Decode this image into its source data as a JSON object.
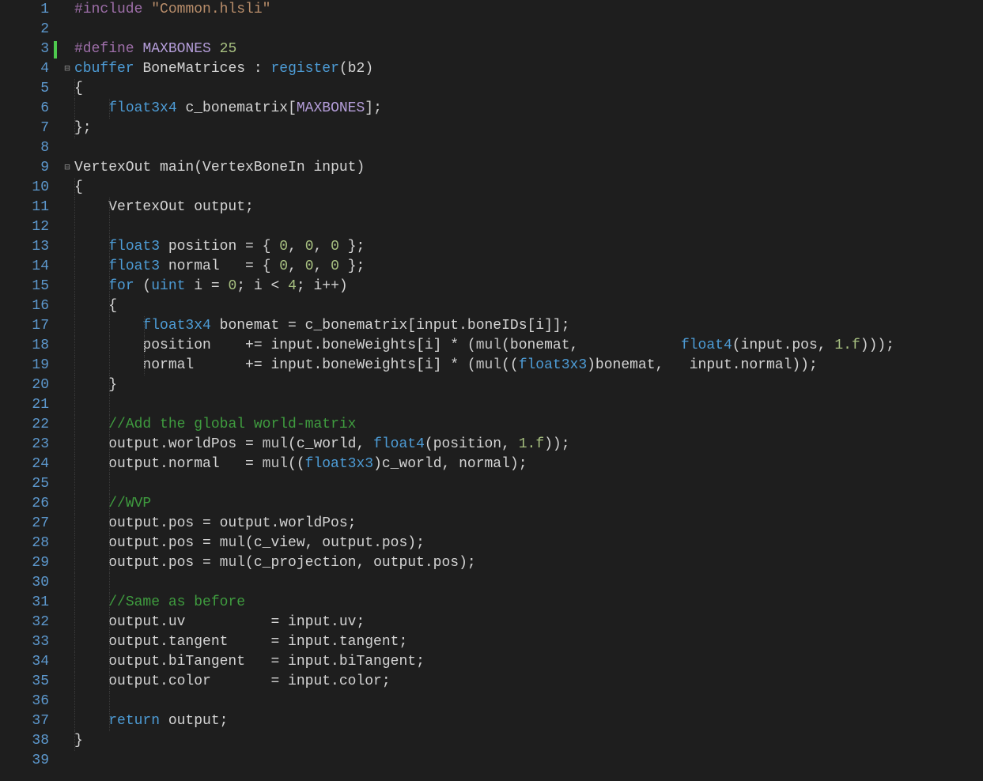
{
  "file_language": "HLSL",
  "line_start": 1,
  "line_end": 39,
  "fold_markers": {
    "4": "-",
    "9": "-"
  },
  "change_markers": {
    "3": true
  },
  "indent_guides": {
    "5": [
      1
    ],
    "6": [
      1,
      2
    ],
    "7": [
      1
    ],
    "10": [
      1
    ],
    "11": [
      1,
      2
    ],
    "12": [
      1,
      2
    ],
    "13": [
      1,
      2
    ],
    "14": [
      1,
      2
    ],
    "15": [
      1,
      2
    ],
    "16": [
      1,
      2
    ],
    "17": [
      1,
      2,
      3
    ],
    "18": [
      1,
      2,
      3
    ],
    "19": [
      1,
      2,
      3
    ],
    "20": [
      1,
      2
    ],
    "21": [
      1,
      2
    ],
    "22": [
      1,
      2
    ],
    "23": [
      1,
      2
    ],
    "24": [
      1,
      2
    ],
    "25": [
      1,
      2
    ],
    "26": [
      1,
      2
    ],
    "27": [
      1,
      2
    ],
    "28": [
      1,
      2
    ],
    "29": [
      1,
      2
    ],
    "30": [
      1,
      2
    ],
    "31": [
      1,
      2
    ],
    "32": [
      1,
      2
    ],
    "33": [
      1,
      2
    ],
    "34": [
      1,
      2
    ],
    "35": [
      1,
      2
    ],
    "36": [
      1,
      2
    ],
    "37": [
      1,
      2
    ],
    "38": [
      1
    ]
  },
  "lines": {
    "1": [
      [
        "preproc",
        "#include"
      ],
      [
        "ident",
        " "
      ],
      [
        "string",
        "\"Common.hlsli\""
      ]
    ],
    "2": [],
    "3": [
      [
        "preproc",
        "#define"
      ],
      [
        "ident",
        " "
      ],
      [
        "macro",
        "MAXBONES"
      ],
      [
        "ident",
        " "
      ],
      [
        "number",
        "25"
      ]
    ],
    "4": [
      [
        "keyword",
        "cbuffer"
      ],
      [
        "ident",
        " "
      ],
      [
        "ident",
        "BoneMatrices"
      ],
      [
        "ident",
        " : "
      ],
      [
        "keyword",
        "register"
      ],
      [
        "ident",
        "("
      ],
      [
        "ident",
        "b2"
      ],
      [
        "ident",
        ")"
      ]
    ],
    "5": [
      [
        "ident",
        "{"
      ]
    ],
    "6": [
      [
        "ident",
        "    "
      ],
      [
        "type",
        "float3x4"
      ],
      [
        "ident",
        " c_bonematrix["
      ],
      [
        "macro",
        "MAXBONES"
      ],
      [
        "ident",
        "];"
      ]
    ],
    "7": [
      [
        "ident",
        "};"
      ]
    ],
    "8": [],
    "9": [
      [
        "ident",
        "VertexOut "
      ],
      [
        "ident",
        "main"
      ],
      [
        "ident",
        "(VertexBoneIn input)"
      ]
    ],
    "10": [
      [
        "ident",
        "{"
      ]
    ],
    "11": [
      [
        "ident",
        "    VertexOut output;"
      ]
    ],
    "12": [],
    "13": [
      [
        "ident",
        "    "
      ],
      [
        "type",
        "float3"
      ],
      [
        "ident",
        " position = { "
      ],
      [
        "number",
        "0"
      ],
      [
        "ident",
        ", "
      ],
      [
        "number",
        "0"
      ],
      [
        "ident",
        ", "
      ],
      [
        "number",
        "0"
      ],
      [
        "ident",
        " };"
      ]
    ],
    "14": [
      [
        "ident",
        "    "
      ],
      [
        "type",
        "float3"
      ],
      [
        "ident",
        " normal   = { "
      ],
      [
        "number",
        "0"
      ],
      [
        "ident",
        ", "
      ],
      [
        "number",
        "0"
      ],
      [
        "ident",
        ", "
      ],
      [
        "number",
        "0"
      ],
      [
        "ident",
        " };"
      ]
    ],
    "15": [
      [
        "ident",
        "    "
      ],
      [
        "keyword",
        "for"
      ],
      [
        "ident",
        " ("
      ],
      [
        "type",
        "uint"
      ],
      [
        "ident",
        " i = "
      ],
      [
        "number",
        "0"
      ],
      [
        "ident",
        "; i < "
      ],
      [
        "number",
        "4"
      ],
      [
        "ident",
        "; i++)"
      ]
    ],
    "16": [
      [
        "ident",
        "    {"
      ]
    ],
    "17": [
      [
        "ident",
        "        "
      ],
      [
        "type",
        "float3x4"
      ],
      [
        "ident",
        " bonemat = c_bonematrix[input.boneIDs[i]];"
      ]
    ],
    "18": [
      [
        "ident",
        "        position    += input.boneWeights[i] * ("
      ],
      [
        "func",
        "mul"
      ],
      [
        "ident",
        "(bonemat,            "
      ],
      [
        "type",
        "float4"
      ],
      [
        "ident",
        "(input.pos, "
      ],
      [
        "number",
        "1.f"
      ],
      [
        "ident",
        ")));"
      ]
    ],
    "19": [
      [
        "ident",
        "        normal      += input.boneWeights[i] * ("
      ],
      [
        "func",
        "mul"
      ],
      [
        "ident",
        "(("
      ],
      [
        "cast",
        "float3x3"
      ],
      [
        "ident",
        ")bonemat,   input.normal));"
      ]
    ],
    "20": [
      [
        "ident",
        "    }"
      ]
    ],
    "21": [],
    "22": [
      [
        "ident",
        "    "
      ],
      [
        "comment",
        "//Add the global world-matrix"
      ]
    ],
    "23": [
      [
        "ident",
        "    output.worldPos = "
      ],
      [
        "func",
        "mul"
      ],
      [
        "ident",
        "(c_world, "
      ],
      [
        "type",
        "float4"
      ],
      [
        "ident",
        "(position, "
      ],
      [
        "number",
        "1.f"
      ],
      [
        "ident",
        "));"
      ]
    ],
    "24": [
      [
        "ident",
        "    output.normal   = "
      ],
      [
        "func",
        "mul"
      ],
      [
        "ident",
        "(("
      ],
      [
        "cast",
        "float3x3"
      ],
      [
        "ident",
        ")c_world, normal);"
      ]
    ],
    "25": [],
    "26": [
      [
        "ident",
        "    "
      ],
      [
        "comment",
        "//WVP"
      ]
    ],
    "27": [
      [
        "ident",
        "    output.pos = output.worldPos;"
      ]
    ],
    "28": [
      [
        "ident",
        "    output.pos = "
      ],
      [
        "func",
        "mul"
      ],
      [
        "ident",
        "(c_view, output.pos);"
      ]
    ],
    "29": [
      [
        "ident",
        "    output.pos = "
      ],
      [
        "func",
        "mul"
      ],
      [
        "ident",
        "(c_projection, output.pos);"
      ]
    ],
    "30": [],
    "31": [
      [
        "ident",
        "    "
      ],
      [
        "comment",
        "//Same as before"
      ]
    ],
    "32": [
      [
        "ident",
        "    output.uv          = input.uv;"
      ]
    ],
    "33": [
      [
        "ident",
        "    output.tangent     = input.tangent;"
      ]
    ],
    "34": [
      [
        "ident",
        "    output.biTangent   = input.biTangent;"
      ]
    ],
    "35": [
      [
        "ident",
        "    output.color       = input.color;"
      ]
    ],
    "36": [],
    "37": [
      [
        "ident",
        "    "
      ],
      [
        "keyword",
        "return"
      ],
      [
        "ident",
        " output;"
      ]
    ],
    "38": [
      [
        "ident",
        "}"
      ]
    ],
    "39": []
  }
}
